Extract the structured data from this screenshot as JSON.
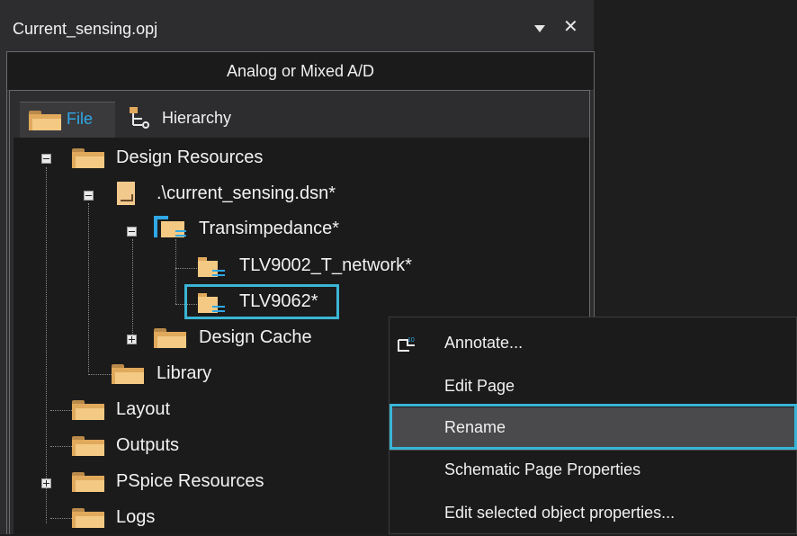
{
  "panel": {
    "title": "Current_sensing.opj",
    "close_glyph": "✕",
    "project_type": "Analog or Mixed A/D",
    "tabs": [
      {
        "label": "File",
        "icon": "folder-icon",
        "active": true
      },
      {
        "label": "Hierarchy",
        "icon": "hierarchy-icon",
        "active": false
      }
    ]
  },
  "tree": {
    "design_resources": "Design Resources",
    "dsn_file": ".\\current_sensing.dsn*",
    "schematic": "Transimpedance*",
    "page1": "TLV9002_T_network*",
    "page2": "TLV9062*",
    "design_cache": "Design Cache",
    "library": "Library",
    "layout": "Layout",
    "outputs": "Outputs",
    "pspice": "PSpice Resources",
    "logs": "Logs"
  },
  "context_menu": {
    "items": [
      {
        "label": "Annotate...",
        "icon": "annotate-icon"
      },
      {
        "label": "Edit Page"
      },
      {
        "label": "Rename",
        "highlighted": true
      },
      {
        "label": "Schematic Page Properties"
      },
      {
        "label": "Edit selected object properties..."
      }
    ]
  },
  "colors": {
    "accent": "#3ab5d6",
    "tab_active_text": "#2fa8e6",
    "folder": "#f3c983"
  }
}
